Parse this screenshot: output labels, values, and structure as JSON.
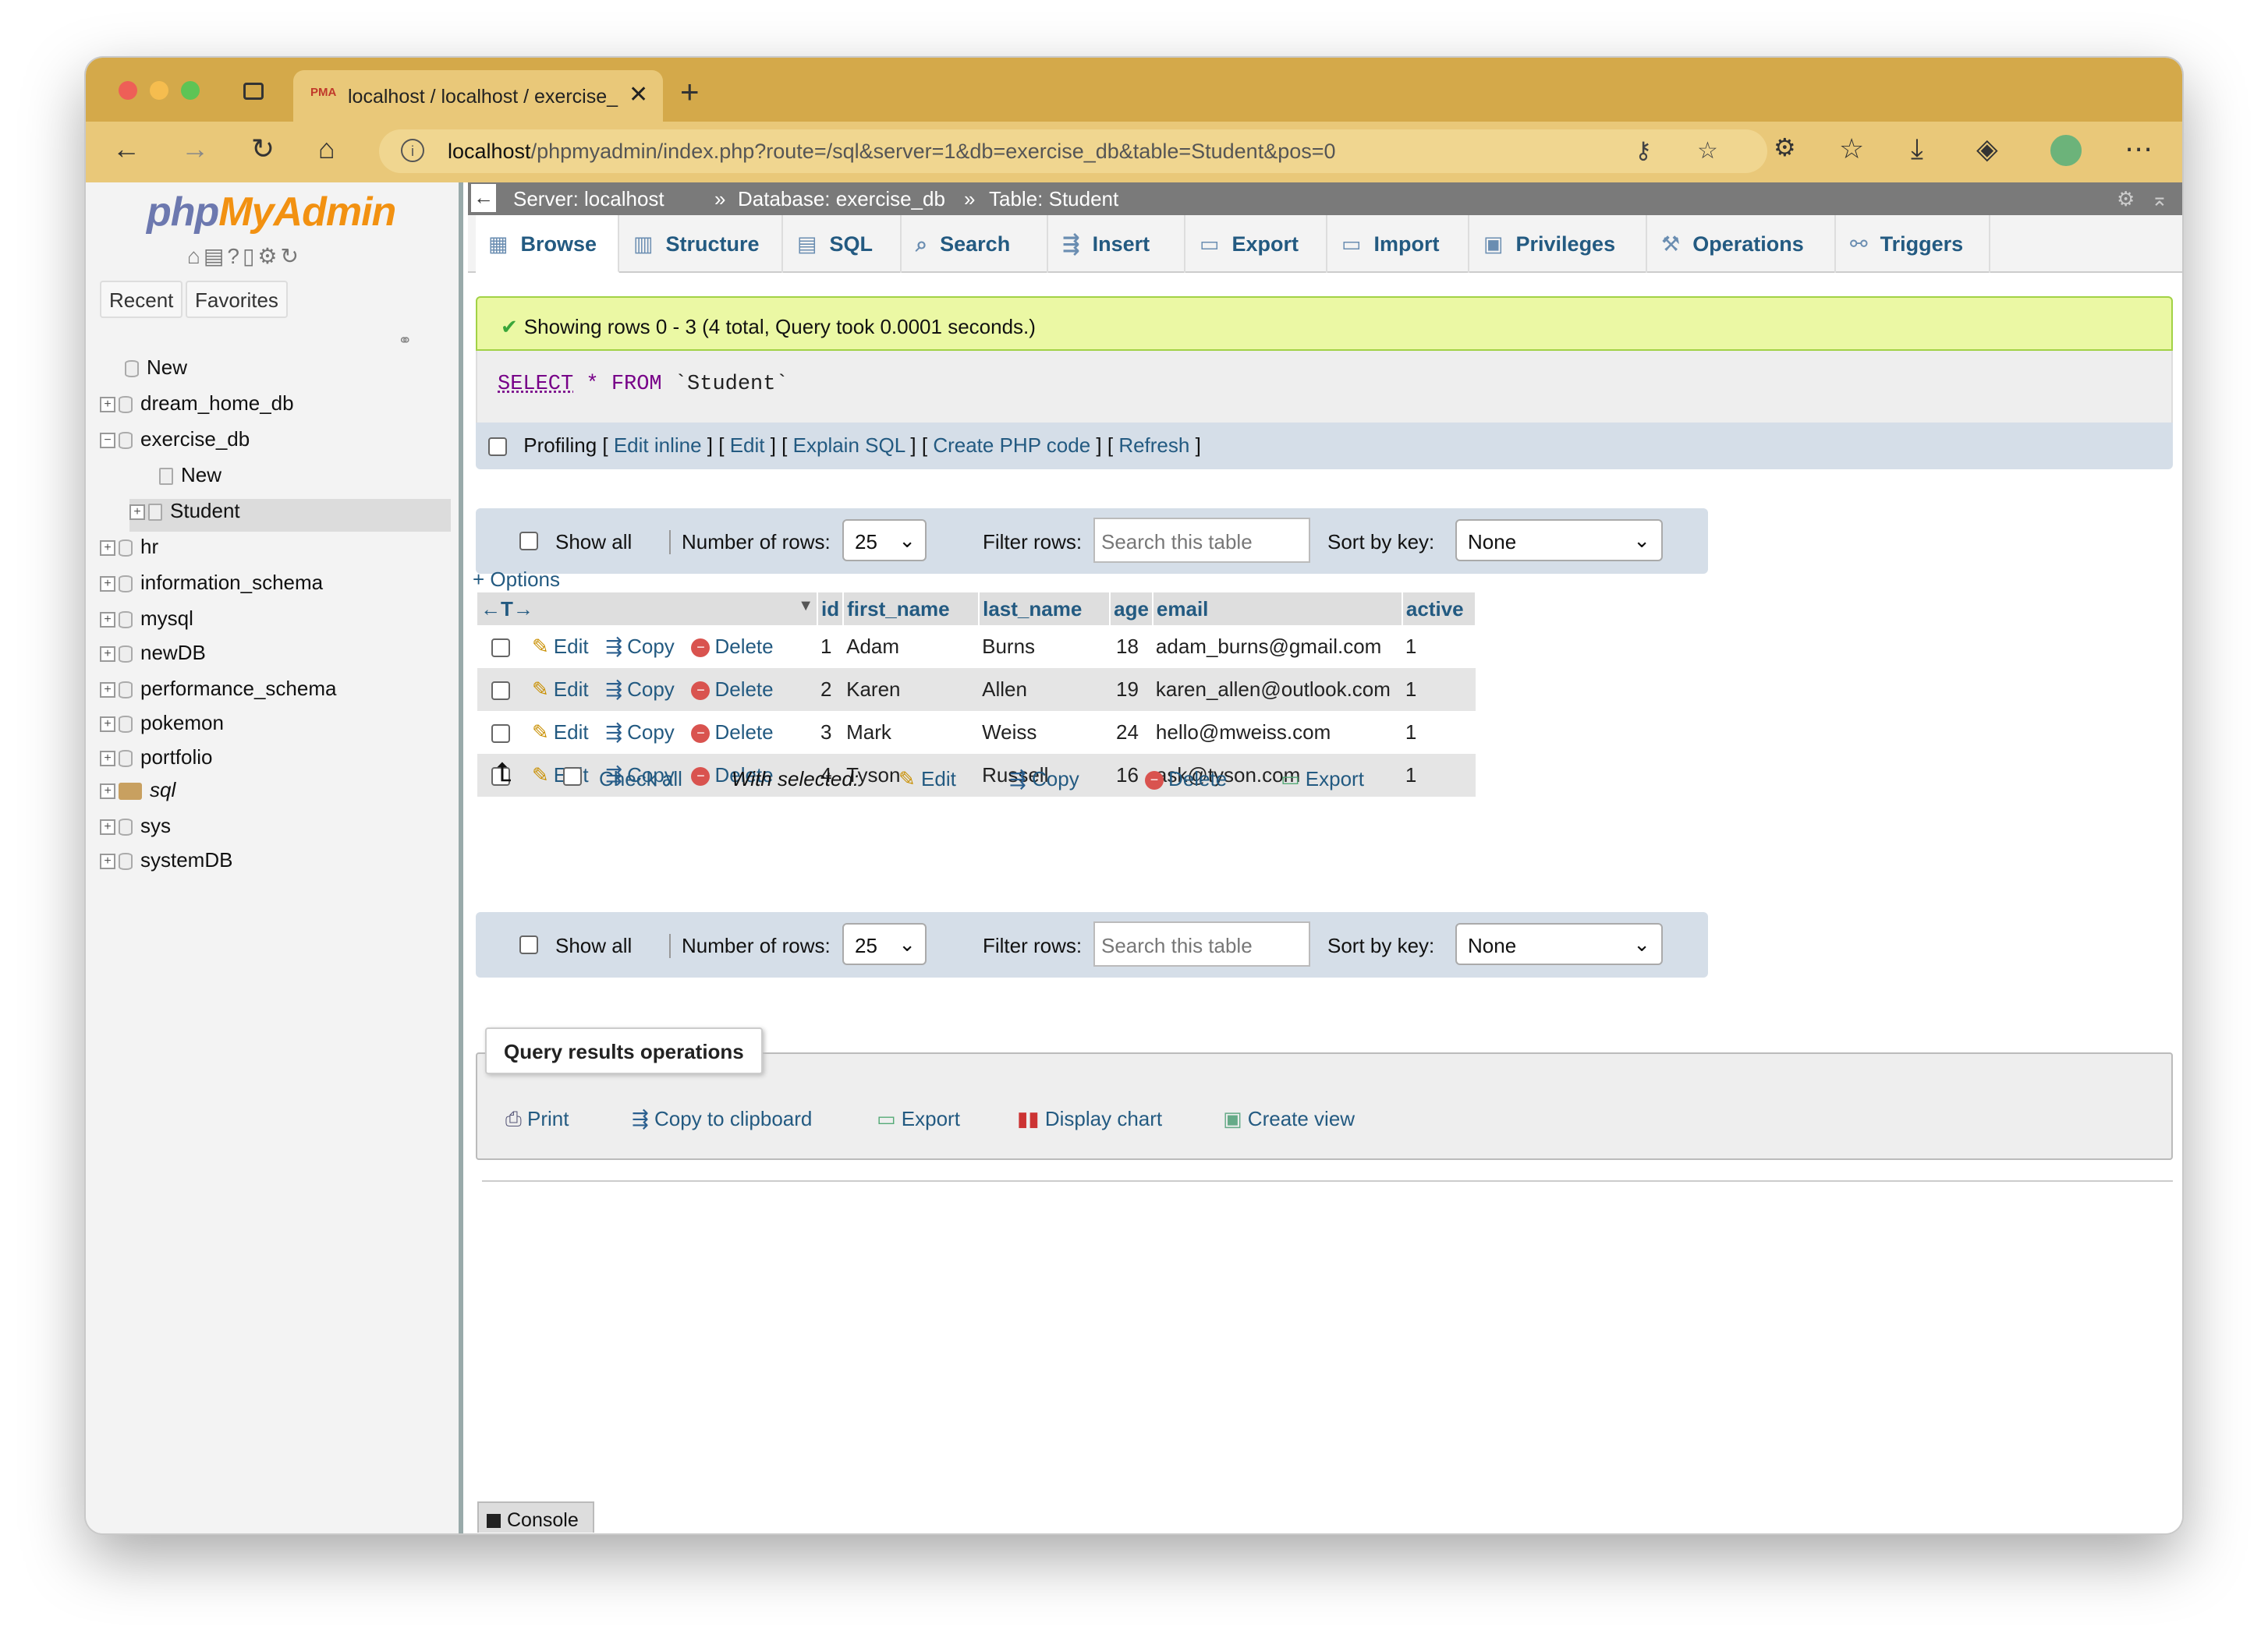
{
  "browser": {
    "tab_title": "localhost / localhost / exercise_",
    "tab_favicon": "PMA",
    "url_host": "localhost",
    "url_path": "/phpmyadmin/index.php?route=/sql&server=1&db=exercise_db&table=Student&pos=0"
  },
  "sidebar": {
    "logo_php": "php",
    "logo_myadmin": "MyAdmin",
    "recent": "Recent",
    "favorites": "Favorites",
    "tree": [
      {
        "label": "New"
      },
      {
        "label": "dream_home_db"
      },
      {
        "label": "exercise_db"
      },
      {
        "label": "New"
      },
      {
        "label": "Student"
      },
      {
        "label": "hr"
      },
      {
        "label": "information_schema"
      },
      {
        "label": "mysql"
      },
      {
        "label": "newDB"
      },
      {
        "label": "performance_schema"
      },
      {
        "label": "pokemon"
      },
      {
        "label": "portfolio"
      },
      {
        "label": "sql"
      },
      {
        "label": "sys"
      },
      {
        "label": "systemDB"
      }
    ]
  },
  "breadcrumb": {
    "server": "Server: localhost",
    "database": "Database: exercise_db",
    "table": "Table: Student",
    "sep": "»"
  },
  "tabs": [
    "Browse",
    "Structure",
    "SQL",
    "Search",
    "Insert",
    "Export",
    "Import",
    "Privileges",
    "Operations",
    "Triggers"
  ],
  "message": "Showing rows 0 - 3 (4 total, Query took 0.0001 seconds.)",
  "sql": {
    "select": "SELECT",
    "star": "*",
    "from": "FROM",
    "table": "`Student`"
  },
  "profiling": {
    "label": "Profiling",
    "edit_inline": "Edit inline",
    "edit": "Edit",
    "explain": "Explain SQL",
    "create_php": "Create PHP code",
    "refresh": "Refresh"
  },
  "nav": {
    "show_all": "Show all",
    "num_rows_label": "Number of rows:",
    "num_rows_value": "25",
    "filter_label": "Filter rows:",
    "filter_placeholder": "Search this table",
    "sort_label": "Sort by key:",
    "sort_value": "None"
  },
  "options_link": "+ Options",
  "table": {
    "columns": [
      "id",
      "first_name",
      "last_name",
      "age",
      "email",
      "active"
    ],
    "action_edit": "Edit",
    "action_copy": "Copy",
    "action_delete": "Delete",
    "rows": [
      [
        "1",
        "Adam",
        "Burns",
        "18",
        "adam_burns@gmail.com",
        "1"
      ],
      [
        "2",
        "Karen",
        "Allen",
        "19",
        "karen_allen@outlook.com",
        "1"
      ],
      [
        "3",
        "Mark",
        "Weiss",
        "24",
        "hello@mweiss.com",
        "1"
      ],
      [
        "4",
        "Tyson",
        "Russell",
        "16",
        "ask@tyson.com",
        "1"
      ]
    ]
  },
  "with_selected": {
    "check_all": "Check all",
    "label": "With selected:",
    "edit": "Edit",
    "copy": "Copy",
    "delete": "Delete",
    "export": "Export"
  },
  "query_ops": {
    "legend": "Query results operations",
    "print": "Print",
    "copy_clipboard": "Copy to clipboard",
    "export": "Export",
    "display_chart": "Display chart",
    "create_view": "Create view"
  },
  "console": "Console",
  "colors": {
    "titlebar": "#d4a94a",
    "link": "#235a81",
    "success_bg": "#ebf8a4"
  }
}
